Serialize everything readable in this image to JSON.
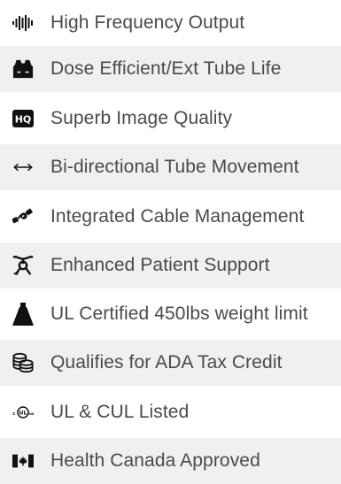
{
  "features": [
    {
      "icon": "sound-wave-icon",
      "label": "High Frequency Output"
    },
    {
      "icon": "vest-icon",
      "label": "Dose Efficient/Ext Tube Life"
    },
    {
      "icon": "hq-badge-icon",
      "label": "Superb Image Quality"
    },
    {
      "icon": "bidirectional-arrow-icon",
      "label": "Bi-directional Tube Movement"
    },
    {
      "icon": "cable-icon",
      "label": "Integrated Cable Management"
    },
    {
      "icon": "patient-support-icon",
      "label": "Enhanced Patient Support"
    },
    {
      "icon": "weight-icon",
      "label": "UL Certified 450lbs weight limit"
    },
    {
      "icon": "coin-stack-icon",
      "label": "Qualifies for ADA Tax Credit"
    },
    {
      "icon": "ul-cul-mark-icon",
      "label": "UL & CUL Listed"
    },
    {
      "icon": "canada-flag-icon",
      "label": "Health Canada Approved"
    }
  ]
}
